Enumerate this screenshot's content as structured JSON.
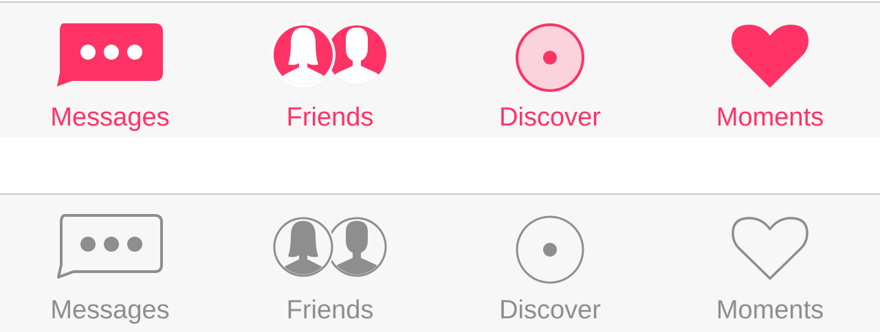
{
  "colors": {
    "active": "#ff3366",
    "active_fill_light": "#fbd3dc",
    "inactive": "#8e8e8e",
    "bar_background": "#f7f7f7",
    "bar_border": "#c9c9c9"
  },
  "tabbar_active": {
    "state": "selected",
    "tabs": [
      {
        "label": "Messages",
        "icon": "chat-bubble-icon"
      },
      {
        "label": "Friends",
        "icon": "friends-icon"
      },
      {
        "label": "Discover",
        "icon": "discover-icon"
      },
      {
        "label": "Moments",
        "icon": "heart-icon"
      }
    ]
  },
  "tabbar_inactive": {
    "state": "unselected",
    "tabs": [
      {
        "label": "Messages",
        "icon": "chat-bubble-outline-icon"
      },
      {
        "label": "Friends",
        "icon": "friends-icon"
      },
      {
        "label": "Discover",
        "icon": "discover-icon"
      },
      {
        "label": "Moments",
        "icon": "heart-outline-icon"
      }
    ]
  }
}
